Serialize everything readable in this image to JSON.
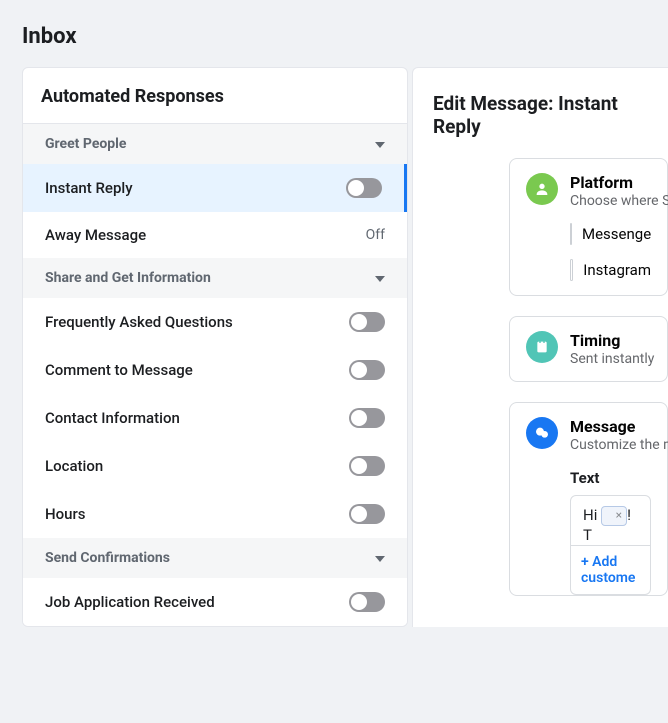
{
  "pageTitle": "Inbox",
  "leftCard": {
    "title": "Automated Responses",
    "sections": {
      "greet": {
        "label": "Greet People"
      },
      "share": {
        "label": "Share and Get Information"
      },
      "confirm": {
        "label": "Send Confirmations"
      }
    },
    "items": {
      "instantReply": {
        "label": "Instant Reply"
      },
      "awayMessage": {
        "label": "Away Message",
        "status": "Off"
      },
      "faq": {
        "label": "Frequently Asked Questions"
      },
      "commentToMessage": {
        "label": "Comment to Message"
      },
      "contactInfo": {
        "label": "Contact Information"
      },
      "location": {
        "label": "Location"
      },
      "hours": {
        "label": "Hours"
      },
      "jobApp": {
        "label": "Job Application Received"
      }
    }
  },
  "rightPanel": {
    "title": "Edit Message: Instant Reply",
    "platform": {
      "title": "Platform",
      "sub": "Choose where S",
      "opts": {
        "messenger": "Messenge",
        "instagram": "Instagram"
      }
    },
    "timing": {
      "title": "Timing",
      "sub": "Sent instantly"
    },
    "message": {
      "title": "Message",
      "sub": "Customize the m",
      "textLabel": "Text",
      "textPrefix": "Hi ",
      "textSuffix": "! T",
      "addLink": "+ Add custome"
    }
  }
}
